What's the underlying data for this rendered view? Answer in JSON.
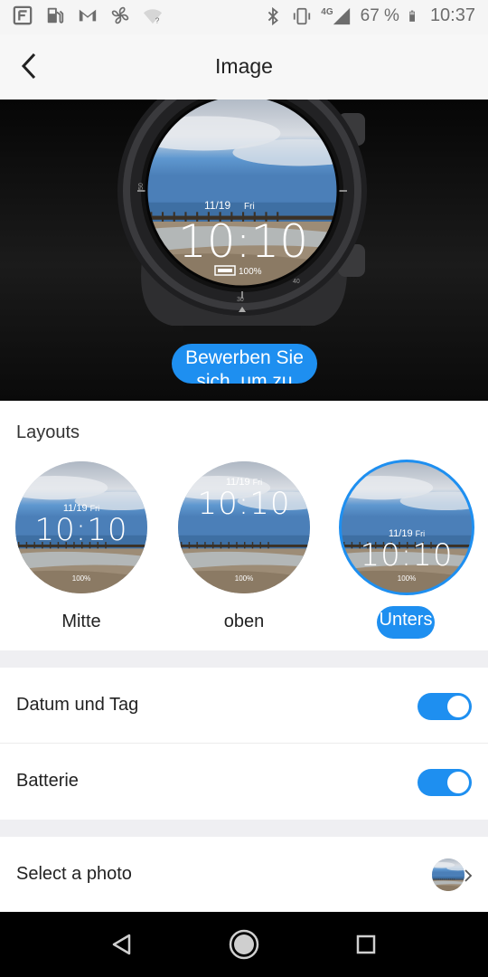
{
  "status_bar": {
    "signal_label": "4G",
    "battery_percent": "67 %",
    "time": "10:37"
  },
  "header": {
    "title": "Image"
  },
  "preview": {
    "date": "11/19",
    "weekday": "Fri",
    "time": "10:10",
    "battery": "100%",
    "bezel_numbers": [
      "30",
      "40",
      "50"
    ],
    "apply_button": "Bewerben Sie sich, um zu"
  },
  "layouts": {
    "heading": "Layouts",
    "options": [
      {
        "label": "Mitte",
        "date": "11/19",
        "weekday": "Fri",
        "time": "10:10",
        "battery": "100%",
        "selected": false
      },
      {
        "label": "oben",
        "date": "11/19",
        "weekday": "Fri",
        "time": "10:10",
        "battery": "100%",
        "selected": false
      },
      {
        "label": "Unters it",
        "date": "11/19",
        "weekday": "Fri",
        "time": "10:10",
        "battery": "100%",
        "selected": true
      }
    ]
  },
  "settings": {
    "date_day": {
      "label": "Datum und Tag",
      "enabled": true
    },
    "battery": {
      "label": "Batterie",
      "enabled": true
    },
    "photo": {
      "label": "Select a photo"
    }
  },
  "colors": {
    "accent": "#1e8ff0",
    "band": "#efeff2"
  },
  "icons": [
    "app-logo-icon",
    "gas-station-icon",
    "gmail-icon",
    "fan-icon",
    "wifi-question-icon",
    "bluetooth-icon",
    "vibrate-icon",
    "signal-icon",
    "battery-icon",
    "back-arrow-icon",
    "chevron-right-icon",
    "nav-back-icon",
    "nav-home-icon",
    "nav-recents-icon"
  ]
}
